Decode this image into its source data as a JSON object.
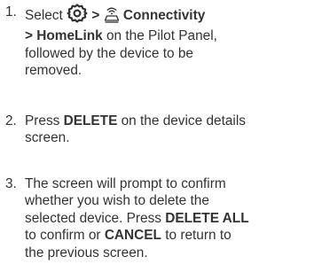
{
  "steps": [
    {
      "number": "1.",
      "line1": {
        "prefix": "Select",
        "gt1": ">",
        "connectivity_label": "Connectivity"
      },
      "line2": {
        "gt2": ">",
        "homelink_label": "HomeLink",
        "suffix": "on the Pilot Panel,"
      },
      "line3": "followed by the device to be",
      "line4": "removed."
    },
    {
      "number": "2.",
      "line1": {
        "prefix": "Press",
        "delete_label": "DELETE",
        "suffix": "on the device details"
      },
      "line2": "screen."
    },
    {
      "number": "3.",
      "line1": "The screen will prompt to confirm",
      "line2": "whether you wish to delete the",
      "line3": {
        "prefix": "selected device. Press",
        "delete_all_label": "DELETE ALL"
      },
      "line4": {
        "prefix": "to confirm or",
        "cancel_label": "CANCEL",
        "suffix": "to return to"
      },
      "line5": "the previous screen."
    }
  ],
  "icons": {
    "settings": "gear-icon",
    "connectivity": "connectivity-icon"
  },
  "colors": {
    "text": "#333333",
    "background": "#ffffff"
  }
}
